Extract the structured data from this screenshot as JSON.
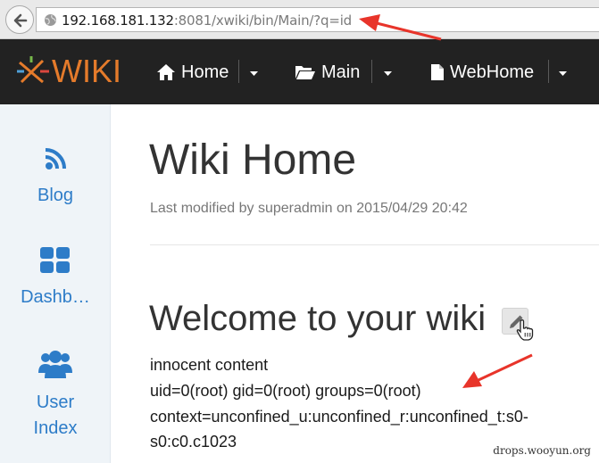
{
  "browser": {
    "url_host": "192.168.181.132",
    "url_rest": ":8081/xwiki/bin/Main/?q=id"
  },
  "header": {
    "logo_text": "WIKI",
    "nav": [
      {
        "label": "Home",
        "icon": "home-icon"
      },
      {
        "label": "Main",
        "icon": "folder-open-icon"
      },
      {
        "label": "WebHome",
        "icon": "document-icon"
      }
    ]
  },
  "sidebar": {
    "items": [
      {
        "label": "Blog",
        "icon": "rss-icon"
      },
      {
        "label": "Dashb…",
        "icon": "dashboard-grid-icon"
      },
      {
        "label_line1": "User",
        "label_line2": "Index",
        "icon": "users-icon"
      }
    ]
  },
  "page": {
    "title": "Wiki Home",
    "last_modified": "Last modified by superadmin on 2015/04/29 20:42",
    "section_heading": "Welcome to your wiki",
    "lines": [
      "innocent content",
      "uid=0(root) gid=0(root) groups=0(root)",
      "context=unconfined_u:unconfined_r:unconfined_t:s0-",
      "s0:c0.c1023"
    ]
  },
  "watermark": "drops.wooyun.org",
  "colors": {
    "logo_orange": "#e57b2b",
    "link_blue": "#2d7cc8",
    "annotation_red": "#e8342a",
    "topbar_bg": "#222222"
  }
}
